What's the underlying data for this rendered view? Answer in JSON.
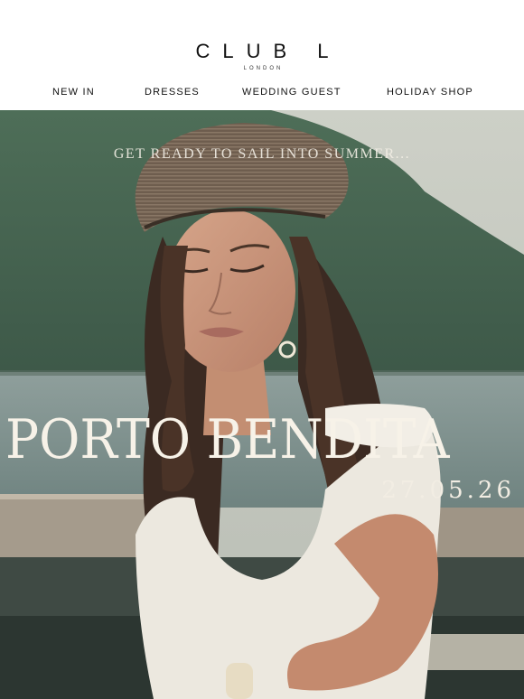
{
  "brand": {
    "logo": "CLUB L",
    "sub": "LONDON"
  },
  "nav": {
    "items": [
      {
        "label": "NEW IN"
      },
      {
        "label": "DRESSES"
      },
      {
        "label": "WEDDING GUEST"
      },
      {
        "label": "HOLIDAY SHOP"
      }
    ]
  },
  "hero": {
    "tagline": "GET READY TO SAIL INTO SUMMER...",
    "title": "PORTO BENDITA",
    "date": "27.05.26"
  },
  "colors": {
    "background": "#ffffff",
    "text": "#111111",
    "hero_text": "#f7f2e8"
  }
}
